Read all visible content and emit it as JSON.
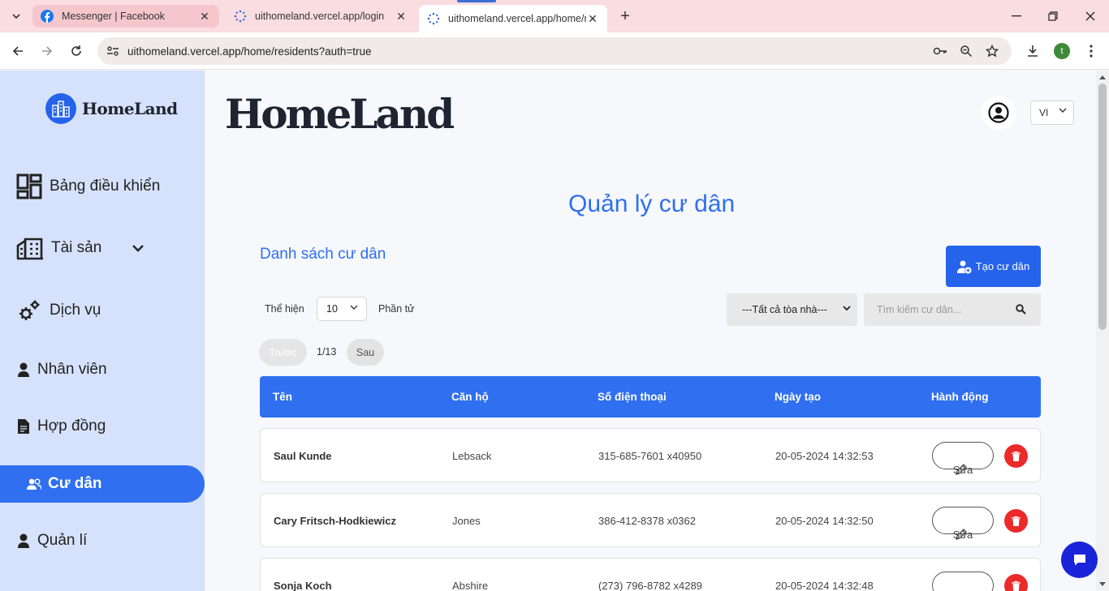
{
  "browser": {
    "tabs": [
      {
        "title": "Messenger | Facebook",
        "icon": "facebook-icon"
      },
      {
        "title": "uithomeland.vercel.app/login",
        "icon": "globe-icon"
      },
      {
        "title": "uithomeland.vercel.app/home/r",
        "icon": "globe-icon"
      }
    ],
    "url": "uithomeland.vercel.app/home/residents?auth=true",
    "profile_initial": "t"
  },
  "sidebar": {
    "brand": "HomeLand",
    "items": [
      {
        "label": "Bảng điều khiển",
        "icon": "dashboard-icon"
      },
      {
        "label": "Tài sản",
        "icon": "building-icon"
      },
      {
        "label": "Dịch vụ",
        "icon": "gears-icon"
      },
      {
        "label": "Nhân viên",
        "icon": "person-icon"
      },
      {
        "label": "Hợp đồng",
        "icon": "contract-icon"
      },
      {
        "label": "Cư dân",
        "icon": "users-icon",
        "active": true
      },
      {
        "label": "Quản lí",
        "icon": "person-icon"
      }
    ]
  },
  "header": {
    "brand": "HomeLand",
    "language": "VI"
  },
  "main": {
    "page_title": "Quản lý cư dân",
    "list_title": "Danh sách cư dân",
    "create_label": "Tạo cư dân",
    "show_label": "Thể hiện",
    "page_size": "10",
    "items_label": "Phần tử",
    "building_filter": "---Tất cả tòa nhà---",
    "search_placeholder": "Tìm kiếm cư dân...",
    "prev_label": "Trước",
    "next_label": "Sau",
    "page_info": "1/13",
    "columns": [
      "Tên",
      "Căn hộ",
      "Số điện thoại",
      "Ngày tạo",
      "Hành động"
    ],
    "edit_label": "Sửa",
    "rows": [
      {
        "name": "Saul Kunde",
        "apartment": "Lebsack",
        "phone": "315-685-7601 x40950",
        "created": "20-05-2024 14:32:53"
      },
      {
        "name": "Cary Fritsch-Hodkiewicz",
        "apartment": "Jones",
        "phone": "386-412-8378 x0362",
        "created": "20-05-2024 14:32:50"
      },
      {
        "name": "Sonja Koch",
        "apartment": "Abshire",
        "phone": "(273) 796-8782 x4289",
        "created": "20-05-2024 14:32:48"
      }
    ]
  },
  "colors": {
    "accent": "#2f6ff0",
    "sidebar_bg": "#d6e2fb",
    "danger": "#ec2a2a",
    "chat": "#1a25d9"
  }
}
